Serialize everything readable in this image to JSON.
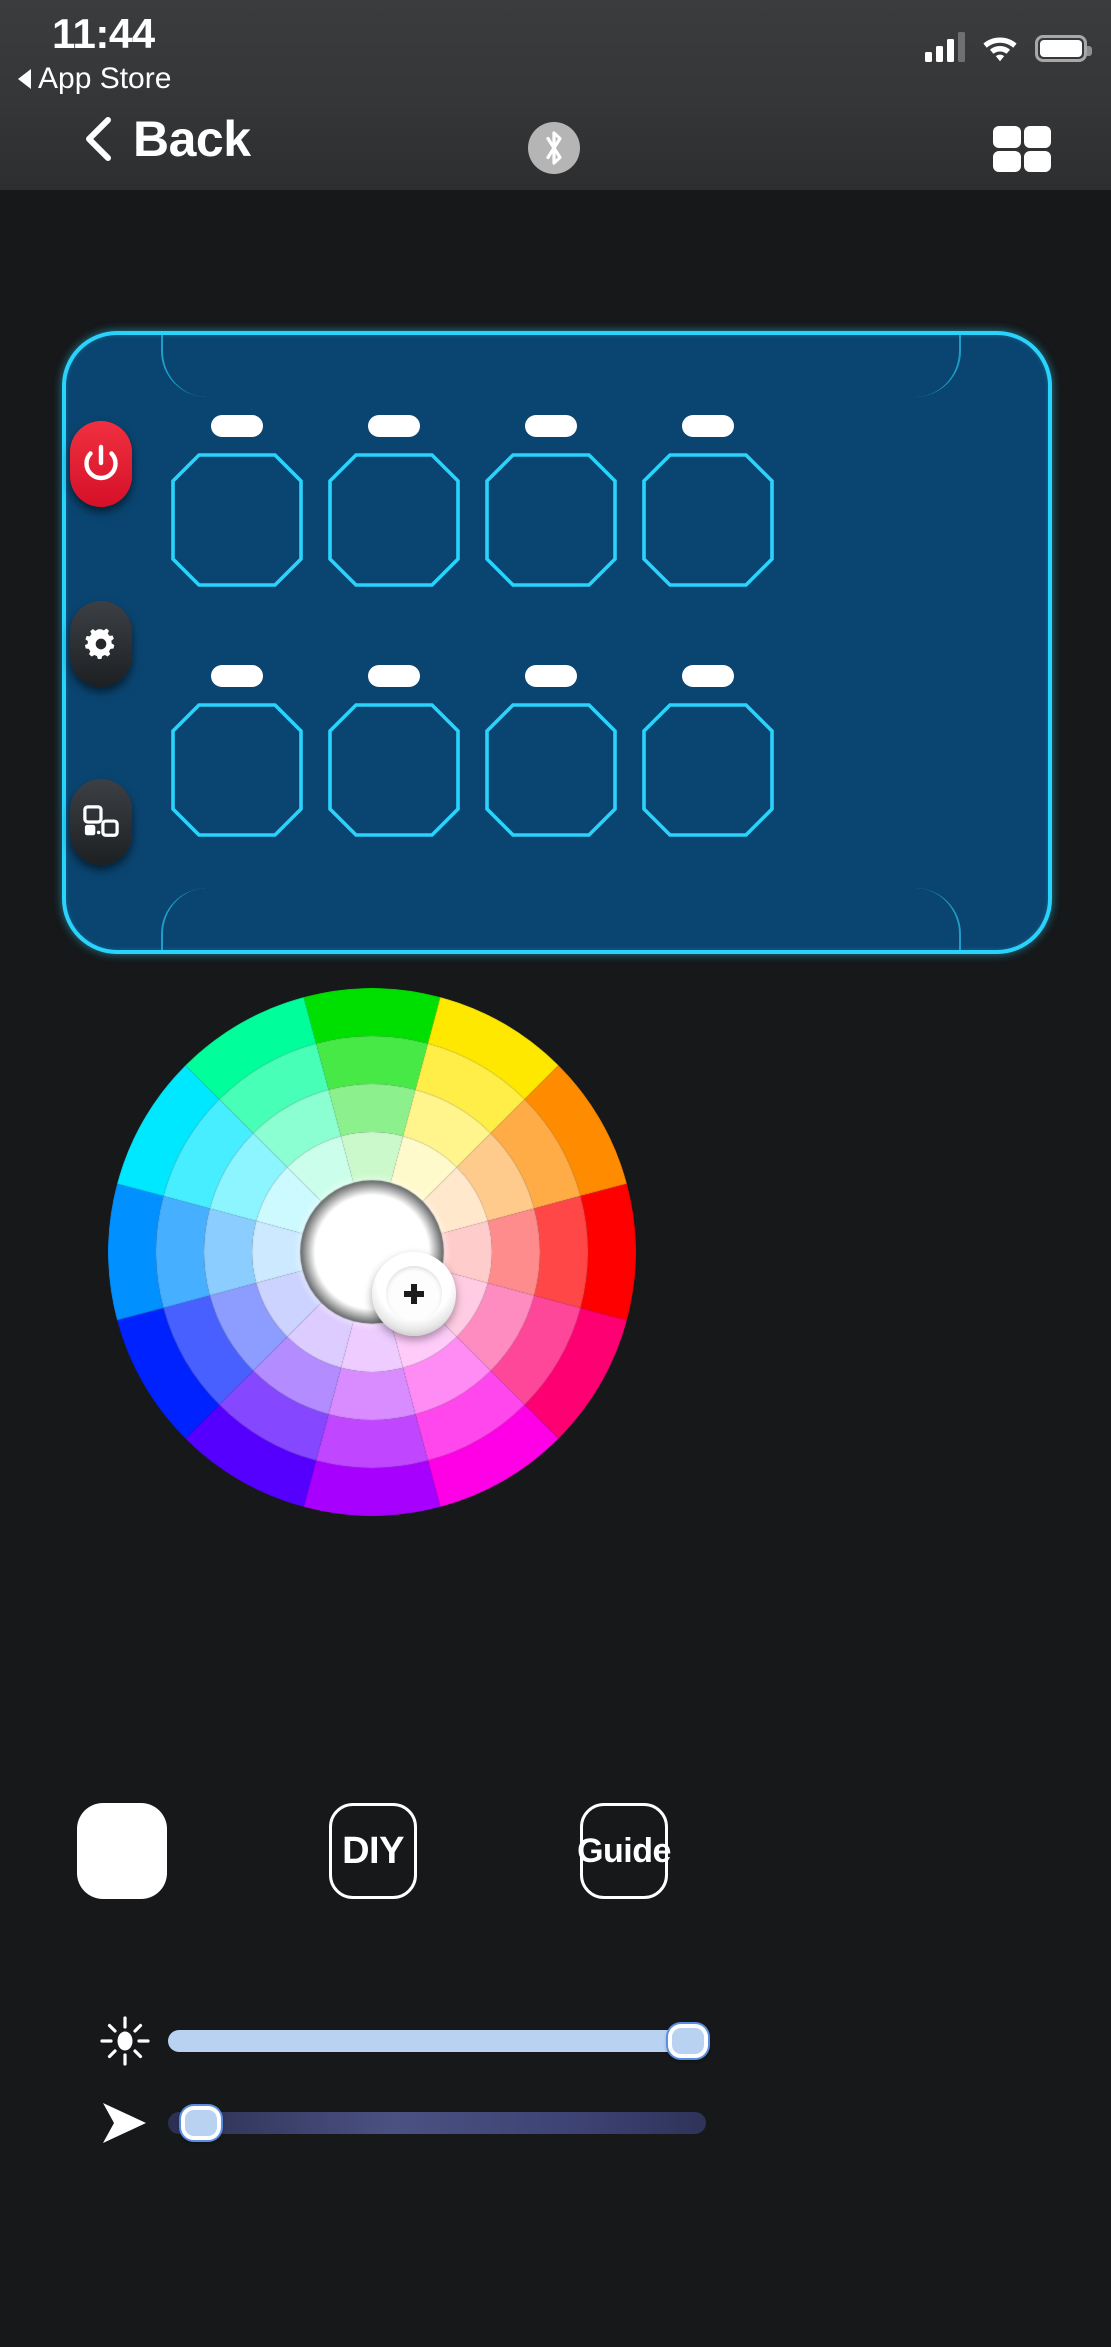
{
  "status_bar": {
    "time": "11:44",
    "return_app_label": "App Store",
    "signal_icon": "cellular-signal-icon",
    "wifi_icon": "wifi-icon",
    "battery_icon": "battery-full-icon"
  },
  "nav_bar": {
    "back_label": "Back",
    "back_icon": "chevron-left-icon",
    "bluetooth_icon": "bluetooth-icon",
    "grid_icon": "grid-2x2-icon"
  },
  "remote_panel": {
    "accent_color": "#2ad3fb",
    "body_color": "#0a4571",
    "side_buttons": [
      {
        "name": "power",
        "icon": "power-icon",
        "color": "#e0203a"
      },
      {
        "name": "settings",
        "icon": "gear-icon",
        "color": "#2b2e31"
      },
      {
        "name": "layout",
        "icon": "layout-panels-icon",
        "color": "#2b2e31"
      }
    ],
    "switch_cells": [
      {
        "id": 1,
        "label": ""
      },
      {
        "id": 2,
        "label": ""
      },
      {
        "id": 3,
        "label": ""
      },
      {
        "id": 4,
        "label": ""
      },
      {
        "id": 5,
        "label": ""
      },
      {
        "id": 6,
        "label": ""
      },
      {
        "id": 7,
        "label": ""
      },
      {
        "id": 8,
        "label": ""
      }
    ]
  },
  "color_wheel": {
    "name": "color-picker-wheel",
    "hue_sectors": 12,
    "saturation_rings": 4,
    "selected_color": "#ffffff",
    "knob_icon": "crosshair-icon",
    "hues": [
      {
        "angle_deg": 0,
        "hex": "#00e000"
      },
      {
        "angle_deg": 30,
        "hex": "#ffe800"
      },
      {
        "angle_deg": 60,
        "hex": "#ff8c00"
      },
      {
        "angle_deg": 90,
        "hex": "#ff0000"
      },
      {
        "angle_deg": 120,
        "hex": "#ff0073"
      },
      {
        "angle_deg": 150,
        "hex": "#ff00e6"
      },
      {
        "angle_deg": 180,
        "hex": "#a800ff"
      },
      {
        "angle_deg": 210,
        "hex": "#5500ff"
      },
      {
        "angle_deg": 240,
        "hex": "#0022ff"
      },
      {
        "angle_deg": 270,
        "hex": "#0090ff"
      },
      {
        "angle_deg": 300,
        "hex": "#00e8ff"
      },
      {
        "angle_deg": 330,
        "hex": "#00ff9b"
      }
    ]
  },
  "actions": {
    "white_swatch_label": "",
    "diy_label": "DIY",
    "guide_label": "Guide"
  },
  "sliders": {
    "brightness": {
      "icon": "brightness-sun-icon",
      "value_percent": 100,
      "track_color": "#b9d2f2"
    },
    "speed": {
      "icon": "speed-arrow-icon",
      "value_percent": 3,
      "track_color": "#3e4375"
    }
  }
}
